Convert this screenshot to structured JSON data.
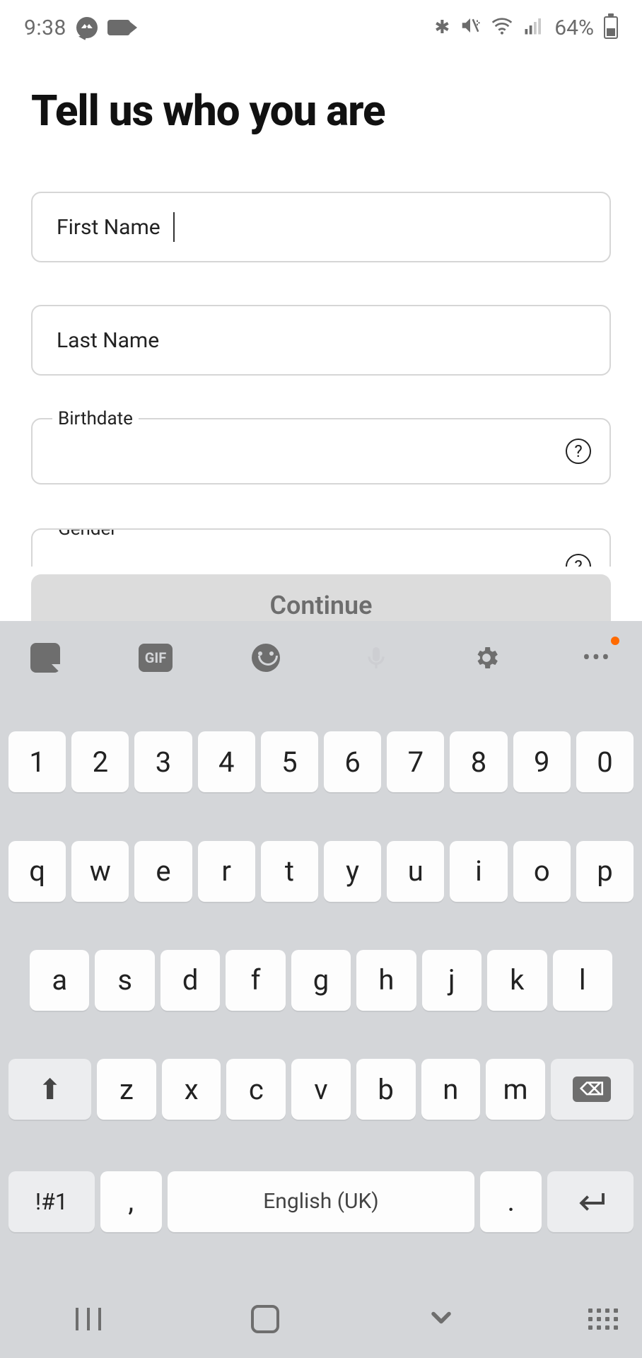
{
  "status": {
    "time": "9:38",
    "battery": "64%"
  },
  "page": {
    "title": "Tell us who you are"
  },
  "fields": {
    "first_name": {
      "label": "First Name",
      "value": ""
    },
    "last_name": {
      "label": "Last Name",
      "value": ""
    },
    "birthdate": {
      "label": "Birthdate",
      "value": ""
    },
    "gender": {
      "label": "Gender",
      "value": ""
    }
  },
  "button": {
    "continue": "Continue"
  },
  "keyboard": {
    "toolbar": {
      "gif": "GIF"
    },
    "row_num": [
      "1",
      "2",
      "3",
      "4",
      "5",
      "6",
      "7",
      "8",
      "9",
      "0"
    ],
    "row_q": [
      "q",
      "w",
      "e",
      "r",
      "t",
      "y",
      "u",
      "i",
      "o",
      "p"
    ],
    "row_a": [
      "a",
      "s",
      "d",
      "f",
      "g",
      "h",
      "j",
      "k",
      "l"
    ],
    "row_z": [
      "z",
      "x",
      "c",
      "v",
      "b",
      "n",
      "m"
    ],
    "sym": "!#1",
    "comma": ",",
    "space": "English (UK)",
    "period": ".",
    "backspace_glyph": "✕",
    "enter_glyph": "↵"
  }
}
